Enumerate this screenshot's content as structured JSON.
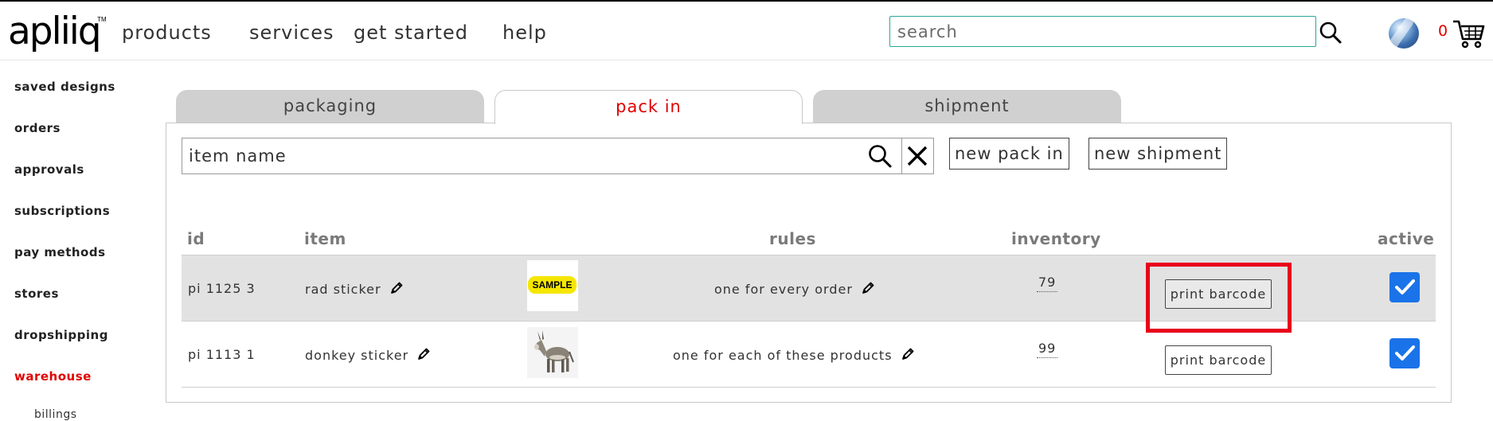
{
  "header": {
    "logo": "apliiq",
    "logo_tm": "TM",
    "nav": [
      "products",
      "services",
      "get started",
      "help"
    ],
    "search_placeholder": "search",
    "cart_count": "0"
  },
  "sidebar": {
    "items": [
      {
        "label": "saved designs"
      },
      {
        "label": "orders"
      },
      {
        "label": "approvals"
      },
      {
        "label": "subscriptions"
      },
      {
        "label": "pay methods"
      },
      {
        "label": "stores"
      },
      {
        "label": "dropshipping"
      },
      {
        "label": "warehouse",
        "active": true
      }
    ],
    "sub_items": [
      "billings"
    ]
  },
  "tabs": [
    {
      "label": "packaging"
    },
    {
      "label": "pack in",
      "active": true
    },
    {
      "label": "shipment"
    }
  ],
  "filter": {
    "placeholder": "item name"
  },
  "buttons": {
    "new_pack_in": "new pack in",
    "new_shipment": "new shipment"
  },
  "table": {
    "columns": [
      "id",
      "item",
      "rules",
      "inventory",
      "active"
    ],
    "rows": [
      {
        "id": "pi 1125 3",
        "item": "rad sticker",
        "thumbnail": "SAMPLE",
        "rule": "one for every order",
        "inventory": "79",
        "button": "print barcode",
        "active": true
      },
      {
        "id": "pi 1113 1",
        "item": "donkey sticker",
        "thumbnail": "donkey",
        "rule": "one for each of these products",
        "inventory": "99",
        "button": "print barcode",
        "active": true
      }
    ]
  },
  "colors": {
    "accent_red": "#e00000",
    "highlight": "#e8001c",
    "checkbox_blue": "#1a73e8",
    "search_border": "#2aa89a"
  }
}
